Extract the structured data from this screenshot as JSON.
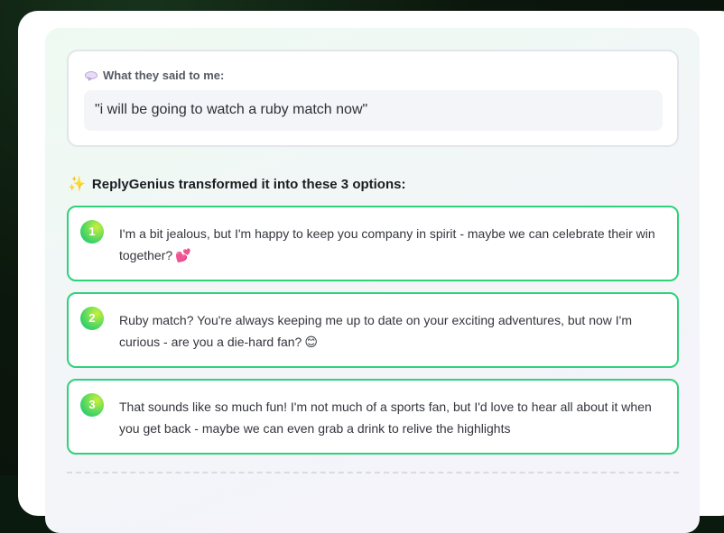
{
  "said": {
    "label": "What they said to me:",
    "icon": "speech-bubble-icon",
    "text": "\"i will be going to watch a ruby match now\""
  },
  "heading": {
    "icon": "sparkles-icon",
    "text": "ReplyGenius transformed it into these 3 options:"
  },
  "options": [
    {
      "number": "1",
      "text": "I'm a bit jealous, but I'm happy to keep you company in spirit - maybe we can celebrate their win together?",
      "emoji": "💕"
    },
    {
      "number": "2",
      "text": "Ruby match? You're always keeping me up to date on your exciting adventures, but now I'm curious - are you a die-hard fan?",
      "emoji": "😊"
    },
    {
      "number": "3",
      "text": "That sounds like so much fun! I'm not much of a sports fan, but I'd love to hear all about it when you get back - maybe we can even grab a drink to relive the highlights",
      "emoji": ""
    }
  ],
  "colors": {
    "accent_green": "#2fd17a",
    "badge_gradient_start": "#c8f03a",
    "badge_gradient_end": "#38d16a"
  }
}
